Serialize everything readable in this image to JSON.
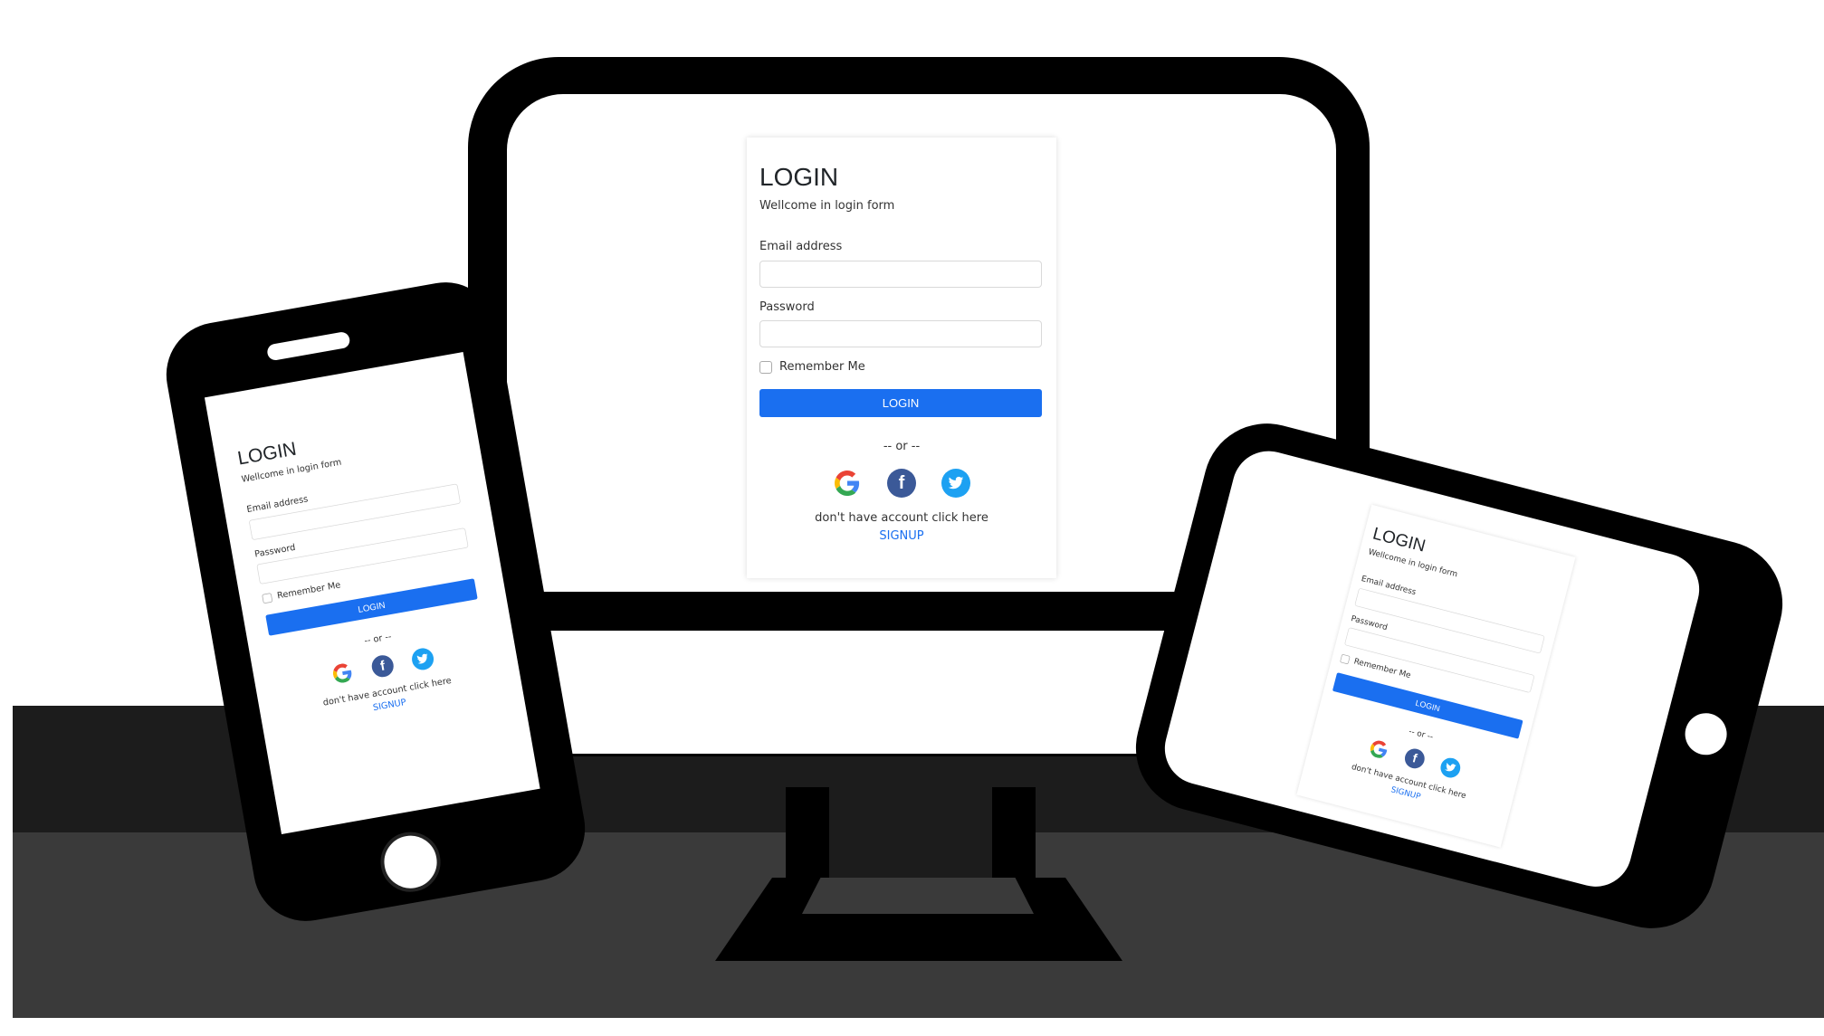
{
  "login_form": {
    "title": "LOGIN",
    "subtitle": "Wellcome in login form",
    "email_label": "Email address",
    "password_label": "Password",
    "remember_label": "Remember Me",
    "login_button": "LOGIN",
    "separator": "-- or --",
    "account_text": "don't have account click here",
    "signup_link": "SIGNUP",
    "socials": [
      "google-icon",
      "facebook-icon",
      "twitter-icon"
    ],
    "colors": {
      "primary": "#1a6ff0",
      "facebook": "#3b5998",
      "twitter": "#1da1f2"
    }
  }
}
